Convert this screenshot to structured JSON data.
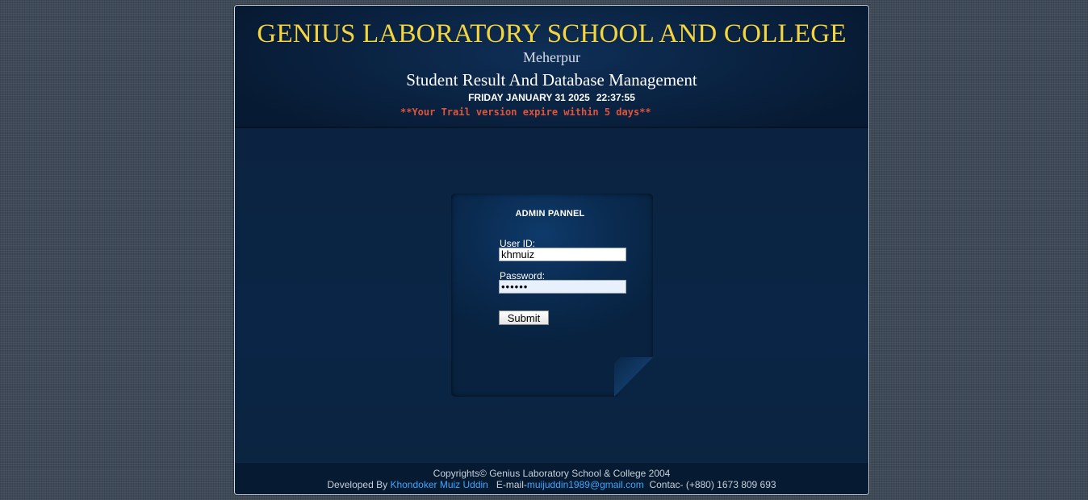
{
  "header": {
    "school_name": "GENIUS LABORATORY SCHOOL AND COLLEGE",
    "location": "Meherpur",
    "subtitle": "Student Result And Database Management",
    "date": "FRIDAY JANUARY 31 2025",
    "time": "22:37:55",
    "trial_notice": "**Your Trail version expire within 5 days**"
  },
  "login": {
    "title": "ADMIN PANNEL",
    "user_label": "User ID:",
    "user_value": "khmuiz",
    "password_label": "Password:",
    "password_value": "••••••",
    "submit_label": "Submit"
  },
  "footer": {
    "copyright": "Copyrights© Genius Laboratory School & College 2004",
    "developed_by_prefix": "Developed By",
    "developer_name": "Khondoker Muiz Uddin",
    "email_prefix": "E-mail-",
    "email": "muijuddin1989@gmail.com",
    "contact": "Contac- (+880) 1673 809 693"
  },
  "colors": {
    "title_yellow": "#f5d53c",
    "trial_red": "#e0543a",
    "link_blue": "#3fa5ff",
    "frame_navy": "#0b2240"
  }
}
